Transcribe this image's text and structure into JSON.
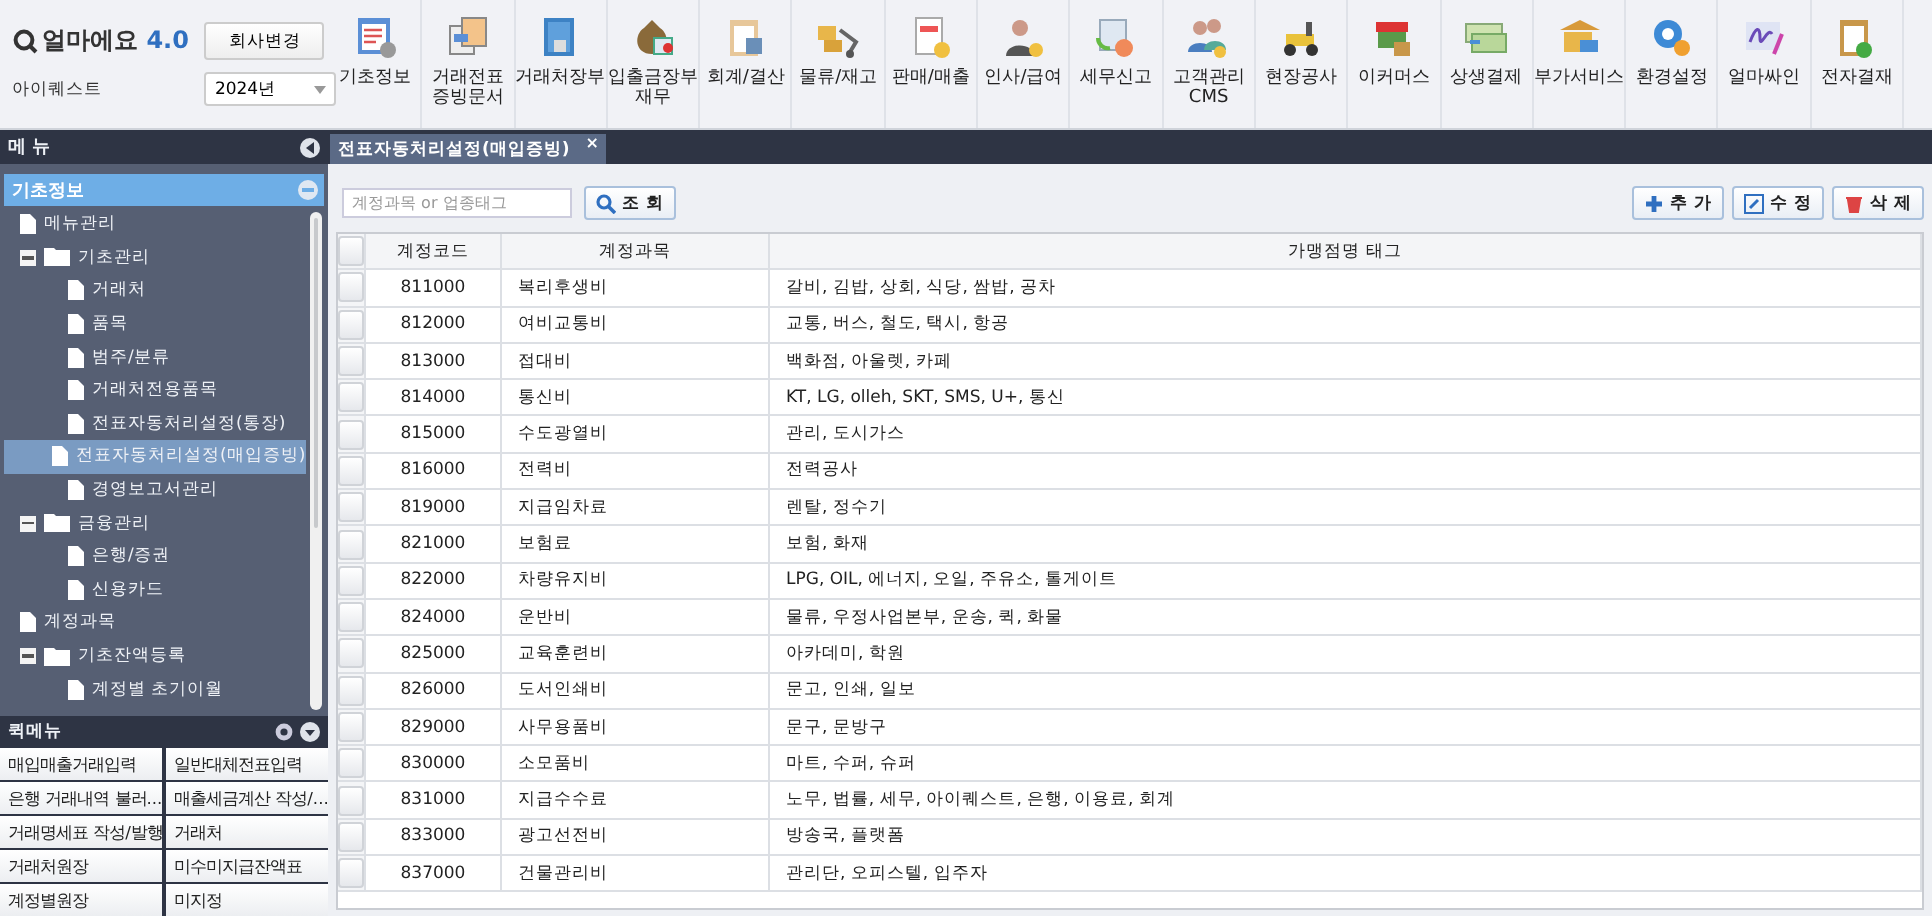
{
  "app": {
    "logo": "얼마에요",
    "version": "4.0",
    "company": "아이퀘스트",
    "company_button": "회사변경",
    "year": "2024년"
  },
  "toolbar": [
    {
      "label": "기초정보"
    },
    {
      "label": "거래전표\n증빙문서"
    },
    {
      "label": "거래처장부"
    },
    {
      "label": "입출금장부\n재무"
    },
    {
      "label": "회계/결산"
    },
    {
      "label": "물류/재고"
    },
    {
      "label": "판매/매출"
    },
    {
      "label": "인사/급여"
    },
    {
      "label": "세무신고"
    },
    {
      "label": "고객관리\nCMS"
    },
    {
      "label": "현장공사"
    },
    {
      "label": "이커머스"
    },
    {
      "label": "상생결제"
    },
    {
      "label": "부가서비스"
    },
    {
      "label": "환경설정"
    },
    {
      "label": "얼마싸인"
    },
    {
      "label": "전자결재"
    }
  ],
  "sidebar": {
    "title": "메 뉴",
    "section": {
      "label": "기초정보",
      "expanded": true
    },
    "tree": [
      {
        "label": "메뉴관리",
        "kind": "page",
        "selected": false
      },
      {
        "label": "기초관리",
        "kind": "folder",
        "expanded": true,
        "selected": false,
        "children": [
          {
            "label": "거래처",
            "kind": "page",
            "selected": false
          },
          {
            "label": "품목",
            "kind": "page",
            "selected": false
          },
          {
            "label": "범주/분류",
            "kind": "page",
            "selected": false
          },
          {
            "label": "거래처전용품목",
            "kind": "page",
            "selected": false
          },
          {
            "label": "전표자동처리설정(통장)",
            "kind": "page",
            "selected": false
          },
          {
            "label": "전표자동처리설정(매입증빙)",
            "kind": "page",
            "selected": true
          },
          {
            "label": "경영보고서관리",
            "kind": "page",
            "selected": false
          }
        ]
      },
      {
        "label": "금융관리",
        "kind": "folder",
        "expanded": true,
        "selected": false,
        "children": [
          {
            "label": "은행/증권",
            "kind": "page",
            "selected": false
          },
          {
            "label": "신용카드",
            "kind": "page",
            "selected": false
          }
        ]
      },
      {
        "label": "계정과목",
        "kind": "page",
        "selected": false
      },
      {
        "label": "기초잔액등록",
        "kind": "folder",
        "expanded": true,
        "selected": false,
        "children": [
          {
            "label": "계정별 초기이월",
            "kind": "page",
            "selected": false
          }
        ]
      }
    ]
  },
  "quick_menu": {
    "title": "퀵메뉴",
    "items": [
      "매입매출거래입력",
      "일반대체전표입력",
      "은행 거래내역 불러...",
      "매출세금계산 작성/...",
      "거래명세표 작성/발행",
      "거래처",
      "거래처원장",
      "미수미지급잔액표",
      "계정별원장",
      "미지정"
    ]
  },
  "tabs": [
    {
      "label": "전표자동처리설정(매입증빙)",
      "selected": true,
      "close": "×"
    }
  ],
  "search": {
    "placeholder": "계정과목 or 업종태그",
    "button": "조 회"
  },
  "actions": [
    "추 가",
    "수 정",
    "삭 제"
  ],
  "table": {
    "all_checked": false,
    "columns": [
      "계정코드",
      "계정과목",
      "가맹점명 태그"
    ],
    "rows": [
      {
        "checked": false,
        "code": "811000",
        "name": "복리후생비",
        "tags": "갈비, 김밥, 상회, 식당, 쌈밥, 공차"
      },
      {
        "checked": false,
        "code": "812000",
        "name": "여비교통비",
        "tags": "교통, 버스, 철도, 택시, 항공"
      },
      {
        "checked": false,
        "code": "813000",
        "name": "접대비",
        "tags": "백화점, 아울렛, 카페"
      },
      {
        "checked": false,
        "code": "814000",
        "name": "통신비",
        "tags": "KT, LG, olleh, SKT, SMS, U+, 통신"
      },
      {
        "checked": false,
        "code": "815000",
        "name": "수도광열비",
        "tags": "관리, 도시가스"
      },
      {
        "checked": false,
        "code": "816000",
        "name": "전력비",
        "tags": "전력공사"
      },
      {
        "checked": false,
        "code": "819000",
        "name": "지급임차료",
        "tags": "렌탈, 정수기"
      },
      {
        "checked": false,
        "code": "821000",
        "name": "보험료",
        "tags": "보험, 화재"
      },
      {
        "checked": false,
        "code": "822000",
        "name": "차량유지비",
        "tags": "LPG, OIL, 에너지, 오일, 주유소, 톨게이트"
      },
      {
        "checked": false,
        "code": "824000",
        "name": "운반비",
        "tags": "물류, 우정사업본부, 운송, 퀵, 화물"
      },
      {
        "checked": false,
        "code": "825000",
        "name": "교육훈련비",
        "tags": "아카데미, 학원"
      },
      {
        "checked": false,
        "code": "826000",
        "name": "도서인쇄비",
        "tags": "문고, 인쇄, 일보"
      },
      {
        "checked": false,
        "code": "829000",
        "name": "사무용품비",
        "tags": "문구, 문방구"
      },
      {
        "checked": false,
        "code": "830000",
        "name": "소모품비",
        "tags": "마트, 수퍼, 슈퍼"
      },
      {
        "checked": false,
        "code": "831000",
        "name": "지급수수료",
        "tags": "노무, 법률, 세무, 아이퀘스트, 은행, 이용료, 회계"
      },
      {
        "checked": false,
        "code": "833000",
        "name": "광고선전비",
        "tags": "방송국, 플랫폼"
      },
      {
        "checked": false,
        "code": "837000",
        "name": "건물관리비",
        "tags": "관리단, 오피스텔, 입주자"
      }
    ]
  }
}
